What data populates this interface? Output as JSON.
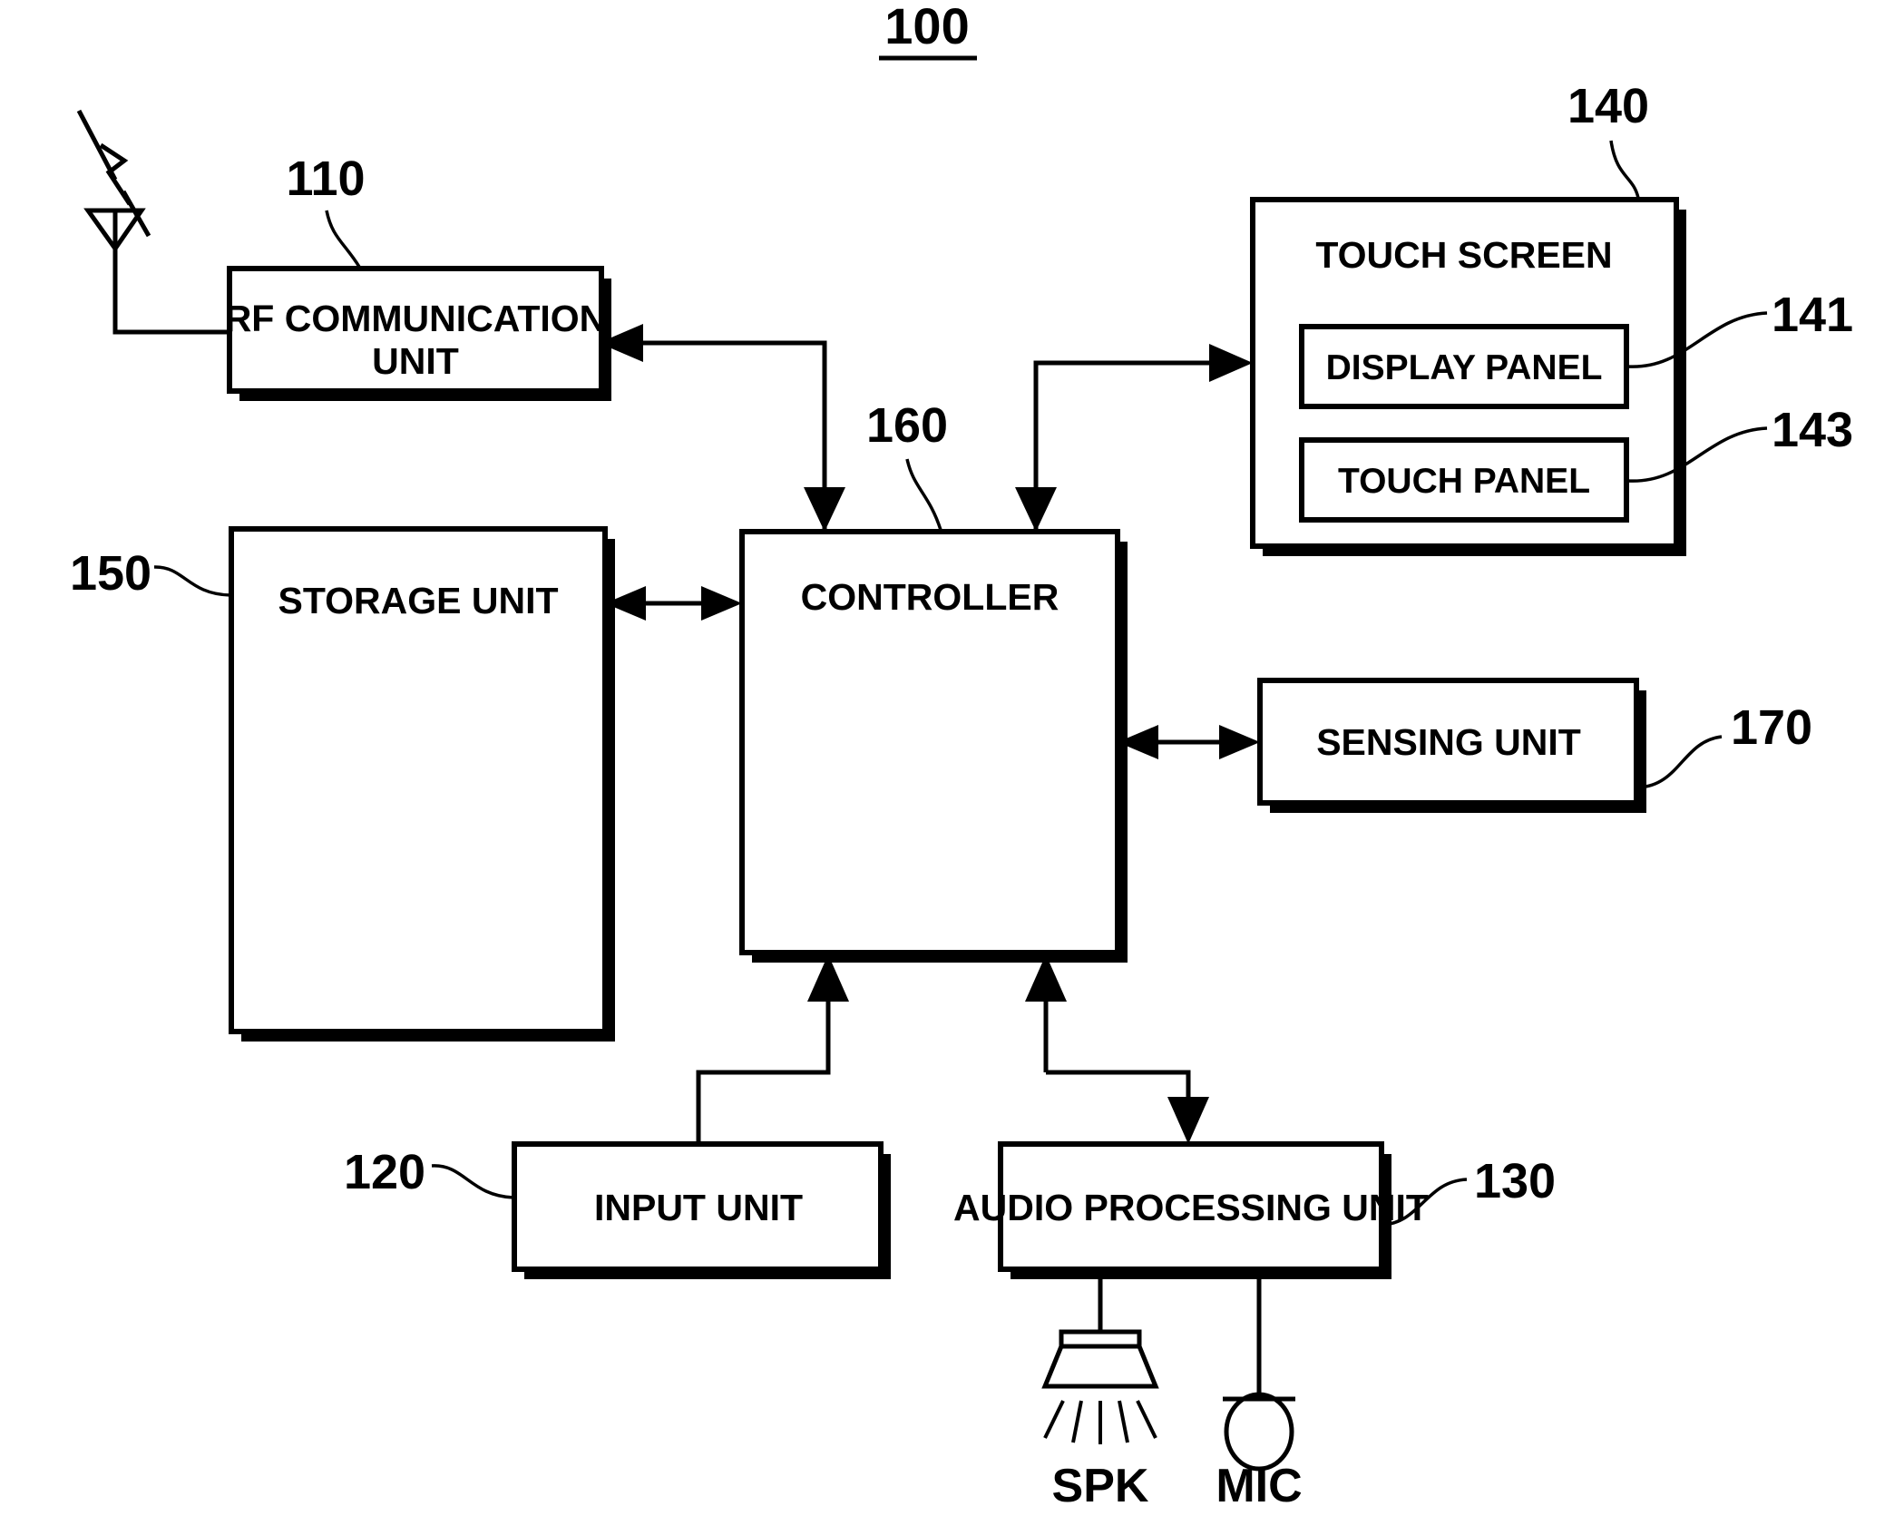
{
  "figure": {
    "number": "100",
    "type": "patent-block-diagram",
    "background_color": "#ffffff",
    "line_color": "#000000"
  },
  "blocks": {
    "rf": {
      "label_line1": "RF COMMUNICATION",
      "label_line2": "UNIT",
      "ref": "110"
    },
    "storage": {
      "label": "STORAGE UNIT",
      "ref": "150"
    },
    "controller": {
      "label": "CONTROLLER",
      "ref": "160"
    },
    "touchscreen": {
      "label": "TOUCH SCREEN",
      "ref": "140"
    },
    "display_panel": {
      "label": "DISPLAY PANEL",
      "ref": "141"
    },
    "touch_panel": {
      "label": "TOUCH PANEL",
      "ref": "143"
    },
    "sensing": {
      "label": "SENSING UNIT",
      "ref": "170"
    },
    "input": {
      "label": "INPUT UNIT",
      "ref": "120"
    },
    "audio": {
      "label": "AUDIO PROCESSING UNIT",
      "ref": "130"
    }
  },
  "peripherals": {
    "speaker": {
      "label": "SPK",
      "icon": "speaker-icon"
    },
    "microphone": {
      "label": "MIC",
      "icon": "microphone-icon"
    },
    "antenna": {
      "icon": "antenna-icon"
    },
    "radio_wave": {
      "icon": "lightning-bolt-icon"
    }
  }
}
